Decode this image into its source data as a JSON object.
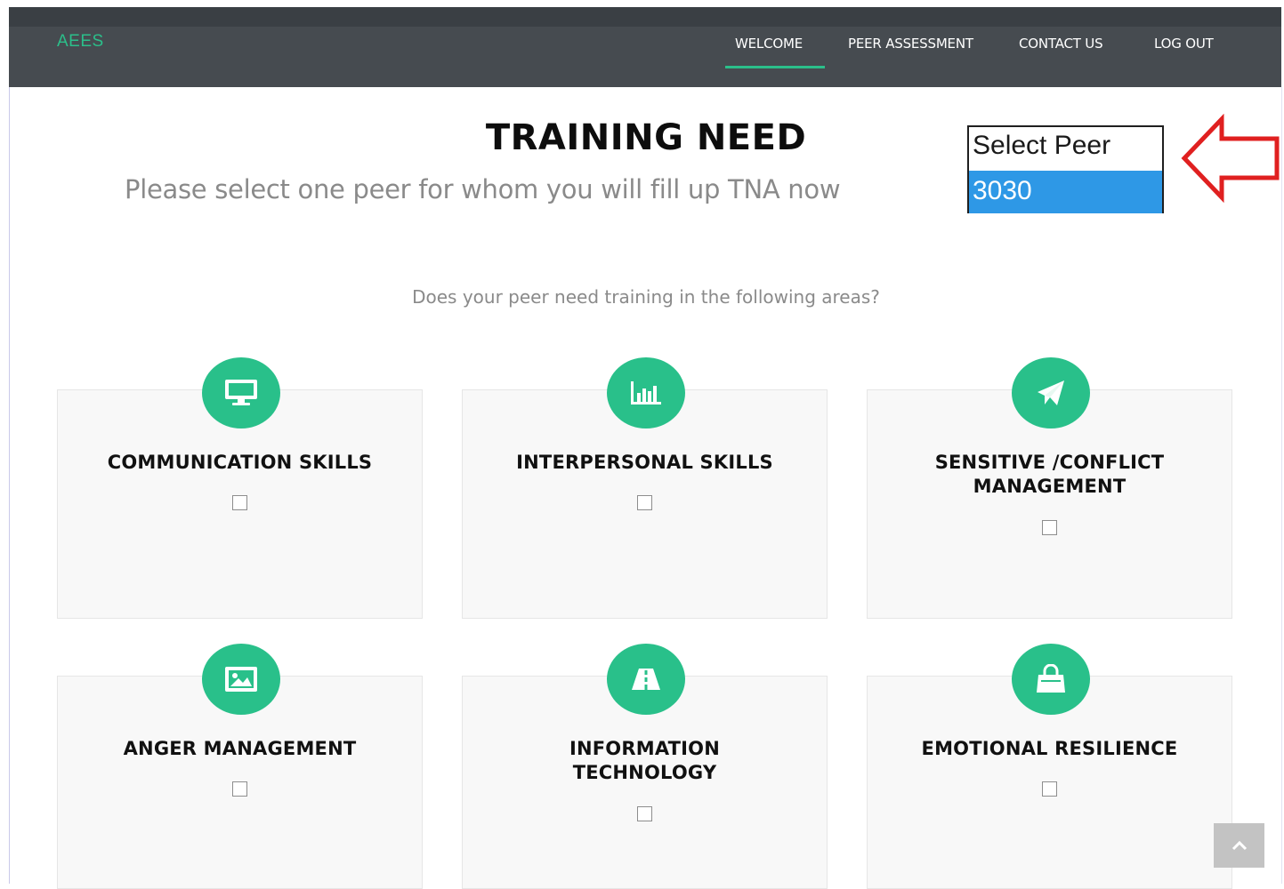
{
  "nav": {
    "brand": "AEES",
    "items": [
      {
        "label": "WELCOME",
        "active": true
      },
      {
        "label": "PEER ASSESSMENT"
      },
      {
        "label": "CONTACT US"
      },
      {
        "label": "LOG OUT"
      }
    ]
  },
  "page": {
    "title": "TRAINING NEED",
    "subtitle": "Please select one peer for whom you will fill up TNA now",
    "question": "Does your peer need training in the following areas?"
  },
  "peer_select": {
    "placeholder": "Select Peer",
    "options": [
      "3030"
    ],
    "highlighted": "3030"
  },
  "areas": [
    {
      "title": "COMMUNICATION SKILLS",
      "icon": "desktop-icon",
      "checked": false
    },
    {
      "title": "INTERPERSONAL SKILLS",
      "icon": "bar-chart-icon",
      "checked": false
    },
    {
      "title": "SENSITIVE /CONFLICT MANAGEMENT",
      "title_line1": "SENSITIVE /CONFLICT",
      "title_line2": "MANAGEMENT",
      "icon": "paper-plane-icon",
      "checked": false
    },
    {
      "title": "ANGER MANAGEMENT",
      "icon": "image-icon",
      "checked": false
    },
    {
      "title": "INFORMATION TECHNOLOGY",
      "title_line1": "INFORMATION",
      "title_line2": "TECHNOLOGY",
      "icon": "road-icon",
      "checked": false
    },
    {
      "title": "EMOTIONAL RESILIENCE",
      "icon": "shopping-bag-icon",
      "checked": false
    }
  ],
  "colors": {
    "accent": "#29c08a",
    "navbar": "#464b50",
    "select_highlight": "#2e98e6",
    "annotation_arrow": "#e02020"
  }
}
